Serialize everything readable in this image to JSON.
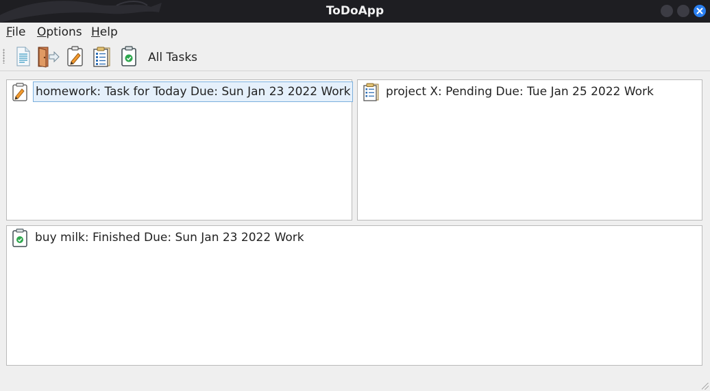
{
  "window": {
    "title": "ToDoApp",
    "accent": "#2a7ff0"
  },
  "menu": {
    "file_rest": "ile",
    "file_mnemonic": "F",
    "options_rest": "ptions",
    "options_mnemonic": "O",
    "help_rest": "elp",
    "help_mnemonic": "H"
  },
  "toolbar": {
    "buttons": [
      {
        "icon": "new-document-icon"
      },
      {
        "icon": "exit-door-icon"
      },
      {
        "icon": "todo-clipboard-pencil-icon"
      },
      {
        "icon": "pending-clipboard-list-icon"
      },
      {
        "icon": "finished-clipboard-check-icon"
      }
    ],
    "filter_label": "All Tasks"
  },
  "lists": {
    "todo": {
      "icon": "clipboard-pencil-icon",
      "items": [
        {
          "text": "homework: Task for Today Due: Sun Jan 23 2022 Work",
          "selected": true
        }
      ]
    },
    "pending": {
      "icon": "clipboard-list-icon",
      "items": [
        {
          "text": "project X: Pending  Due: Tue Jan 25 2022 Work",
          "selected": false
        }
      ]
    },
    "finished": {
      "icon": "clipboard-check-icon",
      "items": [
        {
          "text": "buy milk: Finished  Due: Sun Jan 23 2022 Work",
          "selected": false
        }
      ]
    }
  }
}
